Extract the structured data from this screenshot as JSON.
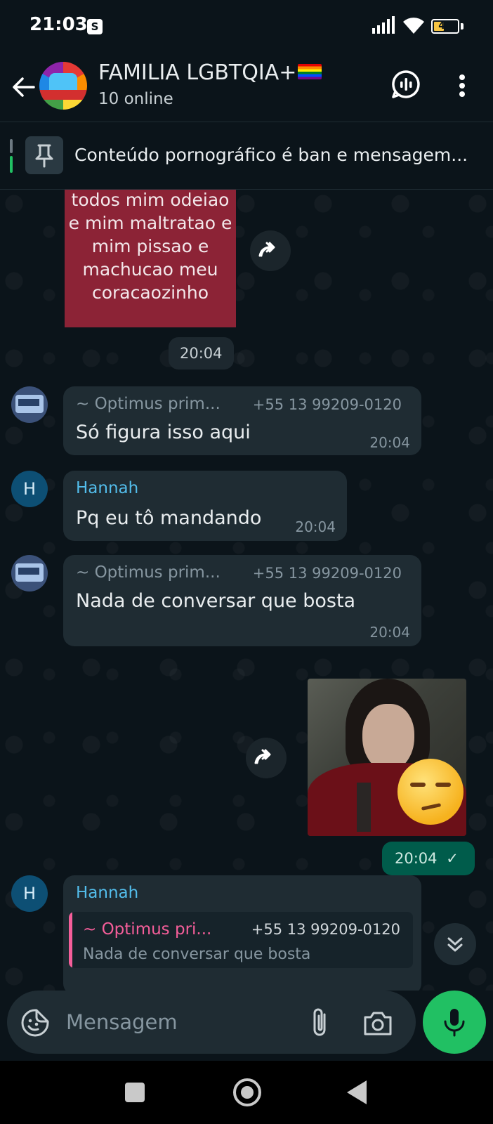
{
  "status_bar": {
    "time": "21:03",
    "notification_icon": "S",
    "battery": "41"
  },
  "header": {
    "group_name": "FAMILIA LGBTQIA+",
    "status": "10 online"
  },
  "pinned": {
    "text": "Conteúdo pornográfico é ban e mensagem..."
  },
  "chat": {
    "sticker_text": "todos mim odeiao e mim maltratao e mim pissao e machucao meu coracaozinho",
    "date_chip": "20:04",
    "messages": [
      {
        "sender": "~ Optimus prim...",
        "phone": "+55 13 99209-0120",
        "text": "Só figura isso aqui",
        "time": "20:04",
        "avatar": "truck"
      },
      {
        "sender": "Hannah",
        "avatar_letter": "H",
        "text": "Pq eu tô mandando",
        "time": "20:04"
      },
      {
        "sender": "~ Optimus prim...",
        "phone": "+55 13 99209-0120",
        "text": "Nada de conversar que bosta",
        "time": "20:04",
        "avatar": "truck"
      }
    ],
    "outgoing": {
      "time": "20:04",
      "check": "✓"
    },
    "reply": {
      "sender": "Hannah",
      "avatar_letter": "H",
      "quoted_sender": "~ Optimus pri...",
      "quoted_phone": "+55 13 99209-0120",
      "quoted_text": "Nada de conversar que bosta"
    }
  },
  "input": {
    "placeholder": "Mensagem"
  },
  "colors": {
    "background": "#0b141a",
    "bubble_incoming": "#1f2c33",
    "bubble_outgoing": "#005c4b",
    "accent_green": "#21c063",
    "sender_blue": "#53bdeb",
    "quote_pink": "#f55e9a"
  }
}
